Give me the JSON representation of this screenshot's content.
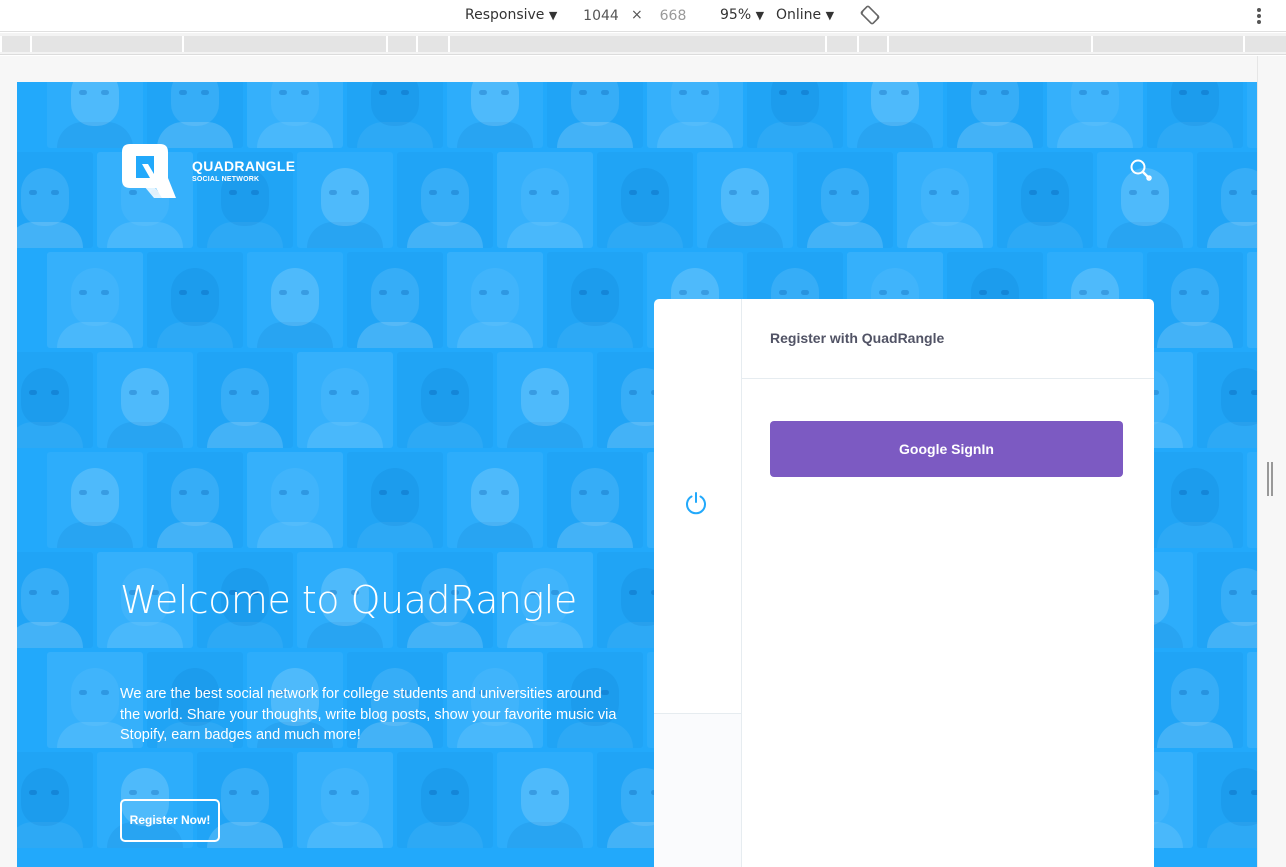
{
  "devtools": {
    "device": "Responsive",
    "width": "1044",
    "height": "668",
    "times": "×",
    "zoom": "95%",
    "throttle": "Online",
    "caret": "▼",
    "rotate_icon": "rotate-icon",
    "menu_icon": "more-vert-icon"
  },
  "header": {
    "brand_name": "QUADRANGLE",
    "brand_tagline": "SOCIAL NETWORK",
    "logo_icon": "quadrangle-logo",
    "search_icon": "search-icon"
  },
  "hero": {
    "title": "Welcome to QuadRangle",
    "description": "We are the best social network for college students and universities around the world. Share your thoughts, write blog posts, show your favorite music via Stopify, earn badges and much more!",
    "cta_label": "Register Now!"
  },
  "register": {
    "title": "Register with QuadRangle",
    "google_label": "Google SignIn",
    "power_icon": "power-icon"
  },
  "colors": {
    "background": "#22a9fb",
    "accent": "#7c5ac2",
    "card": "#ffffff",
    "card_title": "#515365",
    "power_icon": "#22a9fb"
  }
}
